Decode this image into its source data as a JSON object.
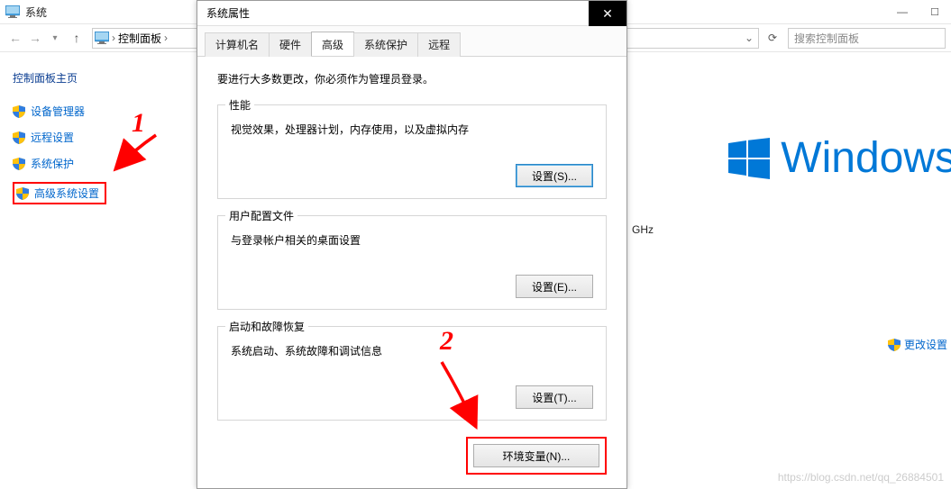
{
  "parent_window": {
    "title": "系统",
    "breadcrumb": {
      "root_sep": "›",
      "item1": "控制面板",
      "sep": "›"
    },
    "search_placeholder": "搜索控制面板"
  },
  "sidebar": {
    "home": "控制面板主页",
    "links": {
      "device_manager": "设备管理器",
      "remote_settings": "远程设置",
      "system_protection": "系统保护",
      "advanced_system": "高级系统设置"
    }
  },
  "right": {
    "brand": "Windows",
    "ghz_fragment": "GHz",
    "change_settings": "更改设置",
    "watermark": "https://blog.csdn.net/qq_26884501"
  },
  "dialog": {
    "title": "系统属性",
    "tabs": {
      "computer_name": "计算机名",
      "hardware": "硬件",
      "advanced": "高级",
      "system_protection": "系统保护",
      "remote": "远程"
    },
    "note": "要进行大多数更改，你必须作为管理员登录。",
    "group_performance": {
      "label": "性能",
      "desc": "视觉效果，处理器计划，内存使用，以及虚拟内存",
      "button": "设置(S)..."
    },
    "group_user_profile": {
      "label": "用户配置文件",
      "desc": "与登录帐户相关的桌面设置",
      "button": "设置(E)..."
    },
    "group_startup": {
      "label": "启动和故障恢复",
      "desc": "系统启动、系统故障和调试信息",
      "button": "设置(T)..."
    },
    "env_button": "环境变量(N)..."
  },
  "annotations": {
    "one": "1",
    "two": "2"
  }
}
